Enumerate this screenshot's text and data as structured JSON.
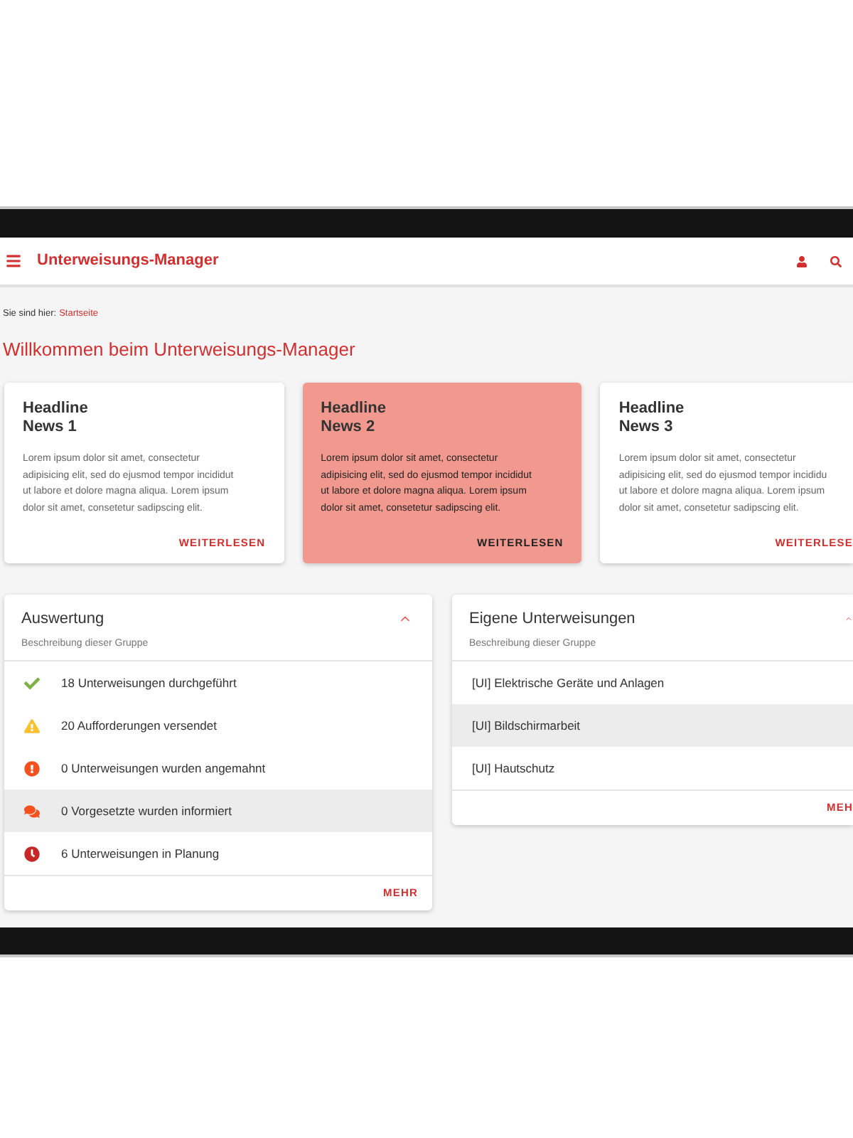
{
  "header": {
    "title": "Unterweisungs-Manager"
  },
  "breadcrumb": {
    "label": "Sie sind hier:",
    "link": "Startseite"
  },
  "heading": "Willkommen beim Unterweisungs-Manager",
  "news": [
    {
      "headline_lines": [
        "Headline",
        "News 1"
      ],
      "body_lines": [
        "Lorem ipsum dolor sit amet, consectetur",
        "adipisicing elit, sed do ejusmod tempor incididut",
        "ut labore et dolore magna aliqua. Lorem ipsum",
        "dolor sit amet, consetetur sadipscing elit."
      ],
      "action": "WEITERLESEN",
      "highlighted": false
    },
    {
      "headline_lines": [
        "Headline",
        "News 2"
      ],
      "body_lines": [
        "Lorem ipsum dolor sit amet, consectetur",
        "adipisicing elit, sed do ejusmod tempor incididut",
        "ut labore et dolore magna aliqua. Lorem ipsum",
        "dolor sit amet, consetetur sadipscing elit."
      ],
      "action": "WEITERLESEN",
      "highlighted": true
    },
    {
      "headline_lines": [
        "Headline",
        "News 3"
      ],
      "body_lines": [
        "Lorem ipsum dolor sit amet, consectetur",
        "adipisicing elit, sed do ejusmod tempor incididu",
        "ut labore et dolore magna aliqua. Lorem ipsum",
        "dolor sit amet, consetetur sadipscing elit."
      ],
      "action": "WEITERLESE",
      "highlighted": false
    }
  ],
  "panels": [
    {
      "title": "Auswertung",
      "description": "Beschreibung dieser Gruppe",
      "expanded": true,
      "action": "MEHR",
      "items": [
        {
          "kind": "done",
          "label": "18 Unterweisungen durchgeführt",
          "highlighted": false
        },
        {
          "kind": "warning",
          "label": "20 Aufforderungen versendet",
          "highlighted": false
        },
        {
          "kind": "alert",
          "label": "0 Unterweisungen wurden angemahnt",
          "highlighted": false
        },
        {
          "kind": "message",
          "label": "0 Vorgesetzte wurden informiert",
          "highlighted": true
        },
        {
          "kind": "planned",
          "label": "6 Unterweisungen in Planung",
          "highlighted": false
        }
      ]
    },
    {
      "title": "Eigene Unterweisungen",
      "description": "Beschreibung dieser Gruppe",
      "expanded": true,
      "action": "MEH",
      "items": [
        {
          "kind": "plain",
          "label": "[UI] Elektrische Geräte und Anlagen",
          "highlighted": false
        },
        {
          "kind": "plain",
          "label": "[UI] Bildschirmarbeit",
          "highlighted": true
        },
        {
          "kind": "plain",
          "label": "[UI] Hautschutz",
          "highlighted": false
        }
      ]
    }
  ]
}
